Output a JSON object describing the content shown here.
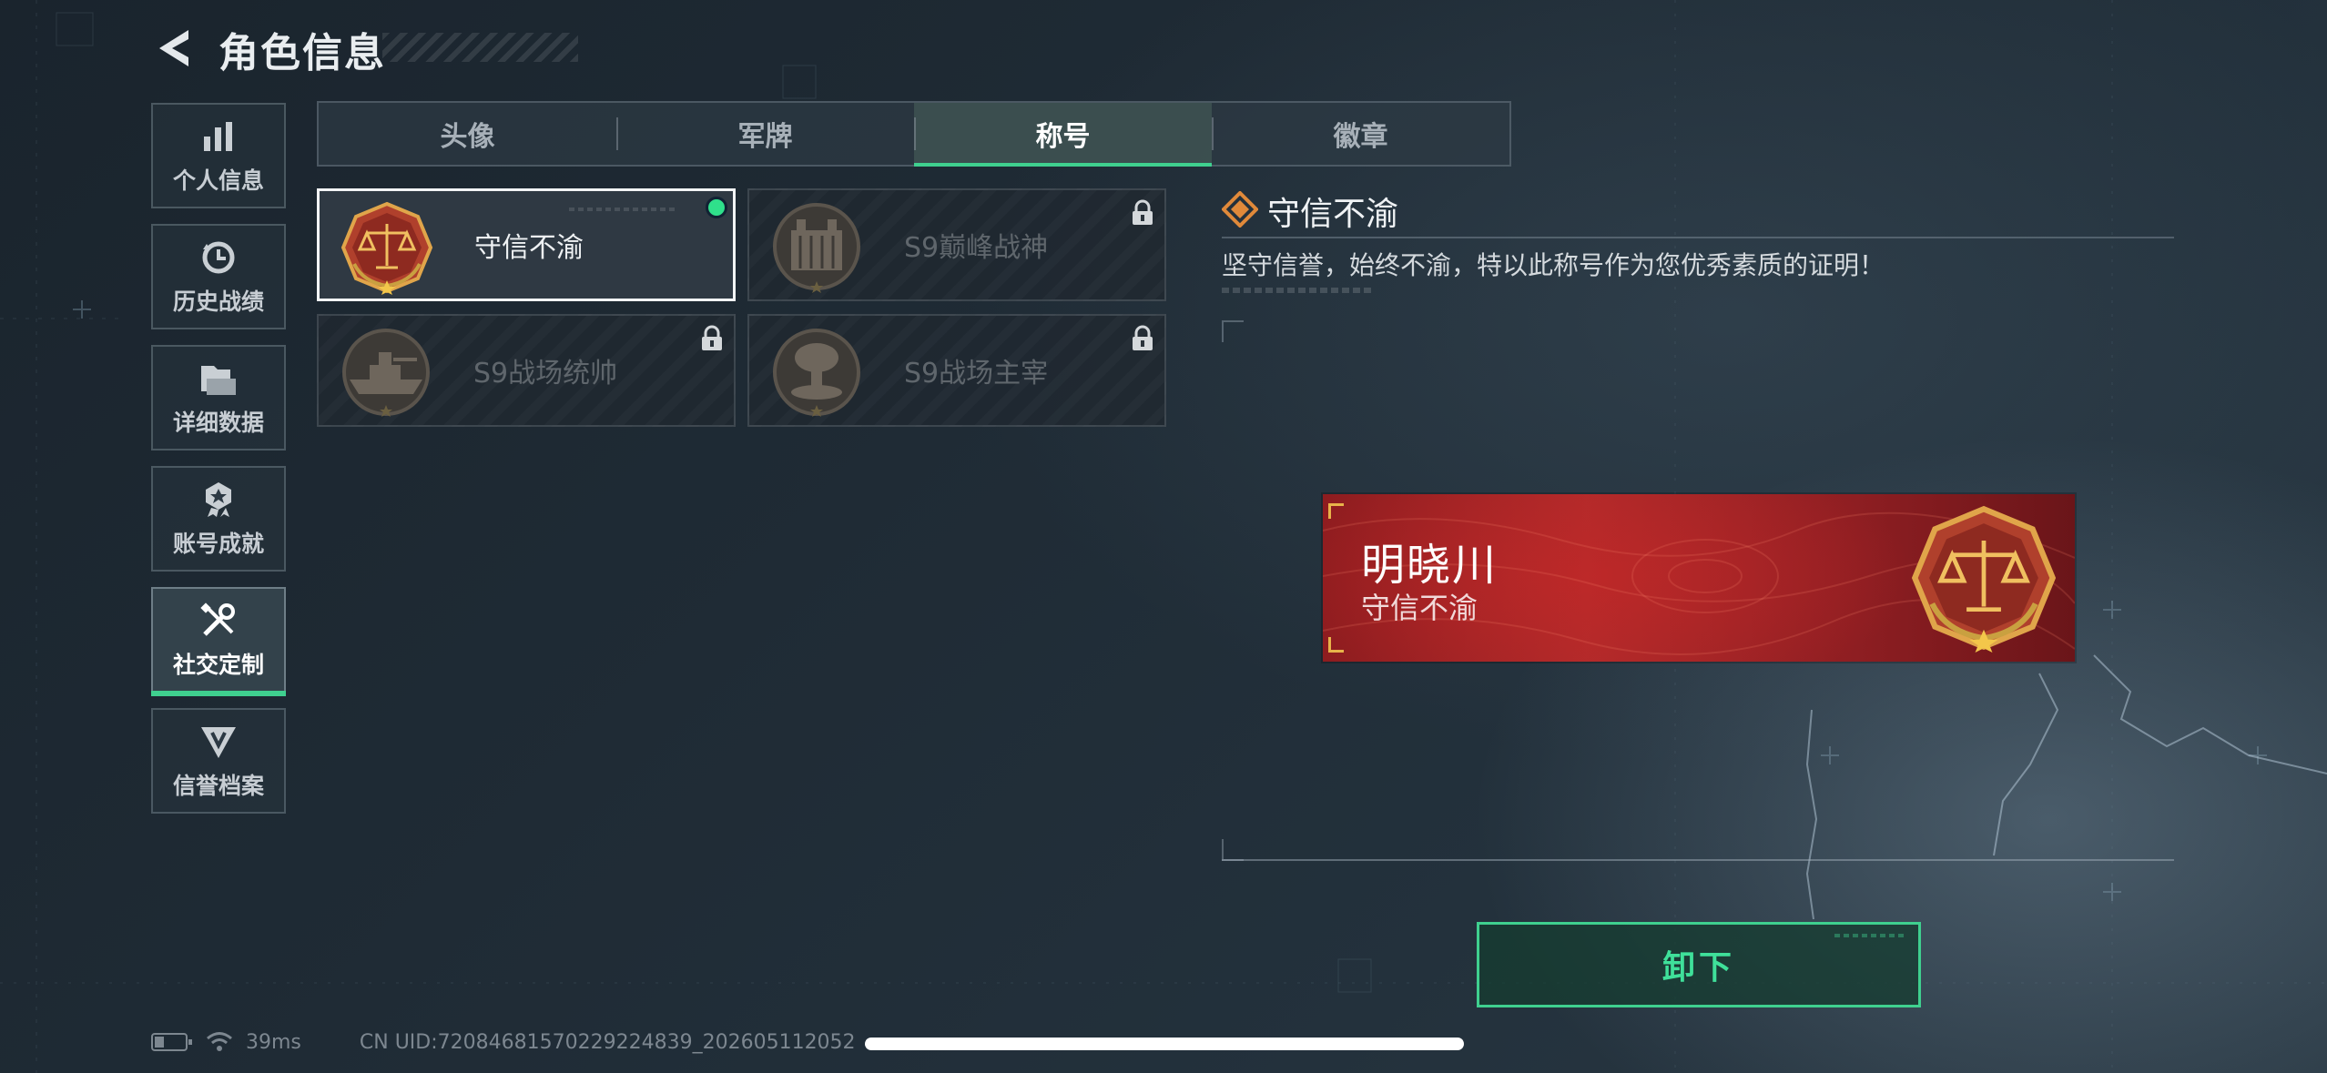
{
  "header": {
    "title": "角色信息"
  },
  "side_nav": {
    "items": [
      {
        "label": "个人信息",
        "icon": "bar-chart-icon",
        "active": false
      },
      {
        "label": "历史战绩",
        "icon": "history-clock-icon",
        "active": false
      },
      {
        "label": "详细数据",
        "icon": "folder-stack-icon",
        "active": false
      },
      {
        "label": "账号成就",
        "icon": "achievement-badge-icon",
        "active": false
      },
      {
        "label": "社交定制",
        "icon": "wrench-screwdriver-icon",
        "active": true
      },
      {
        "label": "信誉档案",
        "icon": "credit-shield-icon",
        "active": false
      }
    ]
  },
  "tabs": [
    {
      "label": "头像",
      "active": false
    },
    {
      "label": "军牌",
      "active": false
    },
    {
      "label": "称号",
      "active": true
    },
    {
      "label": "徽章",
      "active": false
    }
  ],
  "titles": [
    {
      "label": "守信不渝",
      "emblem": "scales-justice-emblem",
      "selected": true,
      "equipped": true,
      "locked": false
    },
    {
      "label": "S9巅峰战神",
      "emblem": "fortress-emblem",
      "selected": false,
      "equipped": false,
      "locked": true
    },
    {
      "label": "S9战场统帅",
      "emblem": "battleship-emblem",
      "selected": false,
      "equipped": false,
      "locked": true
    },
    {
      "label": "S9战场主宰",
      "emblem": "mushroom-cloud-emblem",
      "selected": false,
      "equipped": false,
      "locked": true
    }
  ],
  "detail": {
    "name": "守信不渝",
    "description": "坚守信誉，始终不渝，特以此称号作为您优秀素质的证明！"
  },
  "preview_banner": {
    "player_name": "明晓川",
    "title": "守信不渝",
    "emblem": "scales-justice-emblem"
  },
  "action": {
    "unequip_label": "卸下"
  },
  "status": {
    "ping": "39ms",
    "uid": "CN UID:72084681570229224839_202605112052"
  },
  "colors": {
    "accent_green": "#3fd08f",
    "banner_red": "#b02a2a",
    "emblem_gold": "#d9a441"
  }
}
